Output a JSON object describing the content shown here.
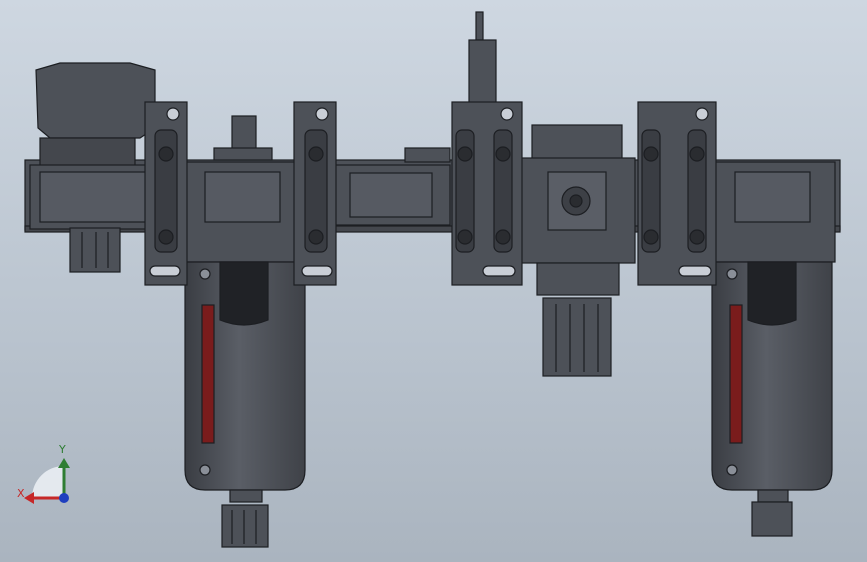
{
  "viewport": {
    "background_top": "#ced7e1",
    "background_bottom": "#aab4bf",
    "model_color": "#4d5158",
    "edge_color": "#1c1e22",
    "sight_glass_color": "#7a1c1c"
  },
  "triad": {
    "x_label": "X",
    "y_label": "Y",
    "x_color": "#c62828",
    "y_color": "#2e7d32",
    "z_color": "#1f3fbf"
  }
}
